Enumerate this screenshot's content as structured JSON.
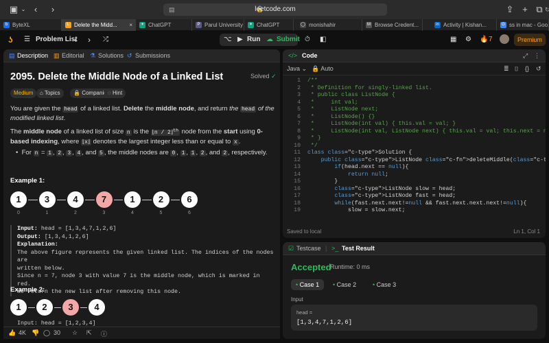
{
  "browser": {
    "url": "leetcode.com",
    "tabs": [
      {
        "label": "ByteXL",
        "color": "#1b6ef3",
        "letter": "b",
        "active": false
      },
      {
        "label": "Delete the Midd...",
        "color": "#ffa116",
        "letter": "L",
        "active": true
      },
      {
        "label": "ChatGPT",
        "color": "#10a37f",
        "letter": "✦",
        "active": false
      },
      {
        "label": "Parul University",
        "color": "#5b5b8a",
        "letter": "P",
        "active": false
      },
      {
        "label": "ChatGPT",
        "color": "#10a37f",
        "letter": "✦",
        "active": false
      },
      {
        "label": "monishahir",
        "color": "#444444",
        "letter": "◯",
        "active": false
      },
      {
        "label": "Browse Credent...",
        "color": "#555555",
        "letter": "M",
        "active": false
      },
      {
        "label": "Activity | Kishan...",
        "color": "#0a66c2",
        "letter": "in",
        "active": false
      },
      {
        "label": "ss in mac - Goo...",
        "color": "#4285f4",
        "letter": "G",
        "active": false
      }
    ]
  },
  "toolbar": {
    "problem_list": "Problem List",
    "run": "Run",
    "submit": "Submit",
    "streak": "7",
    "premium": "Premium"
  },
  "left": {
    "tabs": [
      "Description",
      "Editorial",
      "Solutions",
      "Submissions"
    ],
    "title": "2095. Delete the Middle Node of a Linked List",
    "solved": "Solved",
    "badges": [
      "Medium",
      "Topics",
      "Companies",
      "Hint"
    ],
    "difficulty_color": "#ffb800",
    "example1_title": "Example 1:",
    "example1_nodes": [
      "1",
      "3",
      "4",
      "7",
      "1",
      "2",
      "6"
    ],
    "example1_indices": [
      "0",
      "1",
      "2",
      "3",
      "4",
      "5",
      "6"
    ],
    "example1_input": "head = [1,3,4,7,1,2,6]",
    "example1_output": "[1,3,4,1,2,6]",
    "example1_expl": [
      "The above figure represents the given linked list. The indices of the nodes are",
      "written below.",
      "Since n = 7, node 3 with value 7 is the middle node, which is marked in red.",
      "We return the new list after removing this node."
    ],
    "labels": {
      "input": "Input:",
      "output": "Output:",
      "explanation": "Explanation:"
    },
    "example2_title": "Example 2:",
    "example2_nodes": [
      "1",
      "2",
      "3",
      "4"
    ],
    "example2_partial": "Input: head = [1,2,3,4]",
    "footer": {
      "likes": "4K",
      "comments": "30"
    }
  },
  "code": {
    "header": "Code",
    "language": "Java",
    "mode": "Auto",
    "saved": "Saved to local",
    "position": "Ln 1, Col 1",
    "lines": [
      "/**",
      " * Definition for singly-linked list.",
      " * public class ListNode {",
      " *     int val;",
      " *     ListNode next;",
      " *     ListNode() {}",
      " *     ListNode(int val) { this.val = val; }",
      " *     ListNode(int val, ListNode next) { this.val = val; this.next = next; }",
      " * }",
      " */",
      "class Solution {",
      "    public ListNode deleteMiddle(ListNode head) {",
      "        if(head.next == null){",
      "            return null;",
      "        }",
      "        ListNode slow = head;",
      "        ListNode fast = head;",
      "        while(fast.next.next!=null && fast.next.next.next!=null){",
      "            slow = slow.next;"
    ]
  },
  "test": {
    "tab_testcase": "Testcase",
    "tab_result": "Test Result",
    "status": "Accepted",
    "runtime": "Runtime: 0 ms",
    "cases": [
      "Case 1",
      "Case 2",
      "Case 3"
    ],
    "input_label": "Input",
    "input_name": "head =",
    "input_value": "[1,3,4,7,1,2,6]"
  }
}
